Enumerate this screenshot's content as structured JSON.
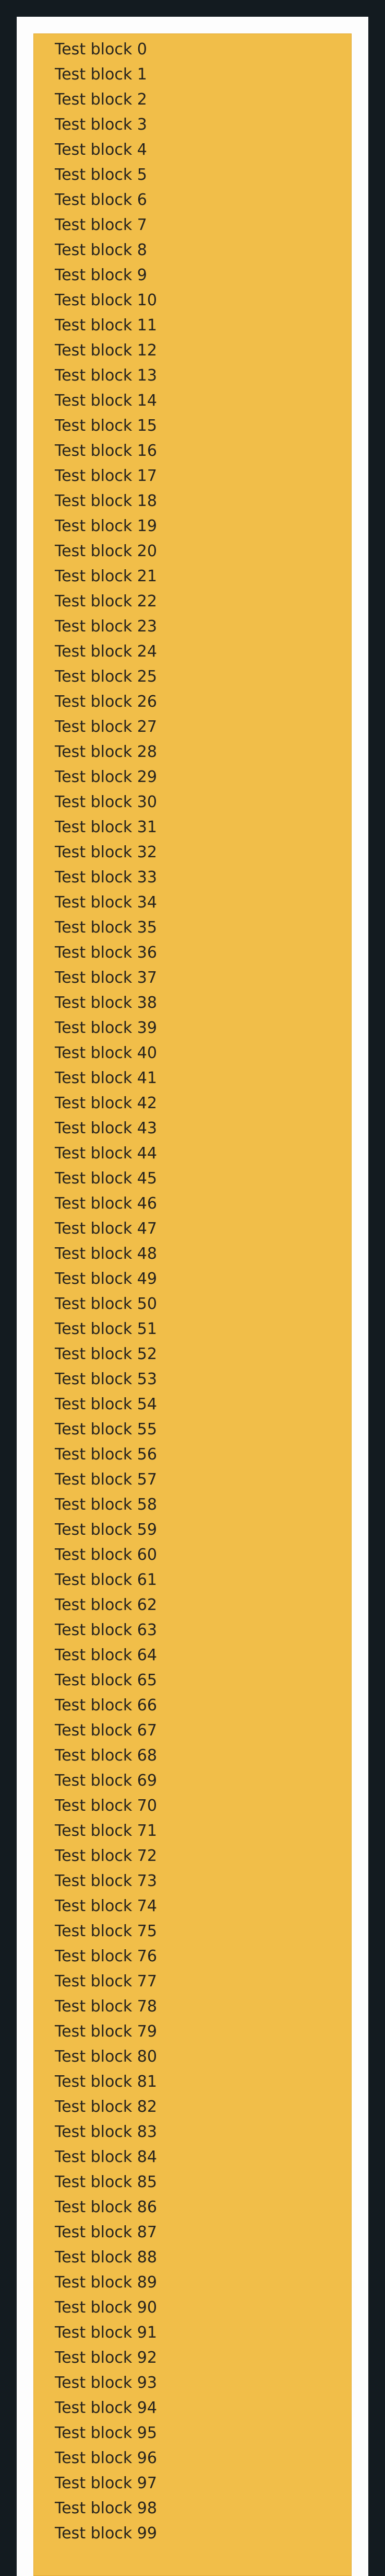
{
  "blocks": [
    "Test block 0",
    "Test block 1",
    "Test block 2",
    "Test block 3",
    "Test block 4",
    "Test block 5",
    "Test block 6",
    "Test block 7",
    "Test block 8",
    "Test block 9",
    "Test block 10",
    "Test block 11",
    "Test block 12",
    "Test block 13",
    "Test block 14",
    "Test block 15",
    "Test block 16",
    "Test block 17",
    "Test block 18",
    "Test block 19",
    "Test block 20",
    "Test block 21",
    "Test block 22",
    "Test block 23",
    "Test block 24",
    "Test block 25",
    "Test block 26",
    "Test block 27",
    "Test block 28",
    "Test block 29",
    "Test block 30",
    "Test block 31",
    "Test block 32",
    "Test block 33",
    "Test block 34",
    "Test block 35",
    "Test block 36",
    "Test block 37",
    "Test block 38",
    "Test block 39",
    "Test block 40",
    "Test block 41",
    "Test block 42",
    "Test block 43",
    "Test block 44",
    "Test block 45",
    "Test block 46",
    "Test block 47",
    "Test block 48",
    "Test block 49",
    "Test block 50",
    "Test block 51",
    "Test block 52",
    "Test block 53",
    "Test block 54",
    "Test block 55",
    "Test block 56",
    "Test block 57",
    "Test block 58",
    "Test block 59",
    "Test block 60",
    "Test block 61",
    "Test block 62",
    "Test block 63",
    "Test block 64",
    "Test block 65",
    "Test block 66",
    "Test block 67",
    "Test block 68",
    "Test block 69",
    "Test block 70",
    "Test block 71",
    "Test block 72",
    "Test block 73",
    "Test block 74",
    "Test block 75",
    "Test block 76",
    "Test block 77",
    "Test block 78",
    "Test block 79",
    "Test block 80",
    "Test block 81",
    "Test block 82",
    "Test block 83",
    "Test block 84",
    "Test block 85",
    "Test block 86",
    "Test block 87",
    "Test block 88",
    "Test block 89",
    "Test block 90",
    "Test block 91",
    "Test block 92",
    "Test block 93",
    "Test block 94",
    "Test block 95",
    "Test block 96",
    "Test block 97",
    "Test block 98",
    "Test block 99"
  ],
  "colors": {
    "page_background": "#131b20",
    "frame_background": "#fdfdfd",
    "panel_background": "#f1be49",
    "text": "#26231d"
  }
}
